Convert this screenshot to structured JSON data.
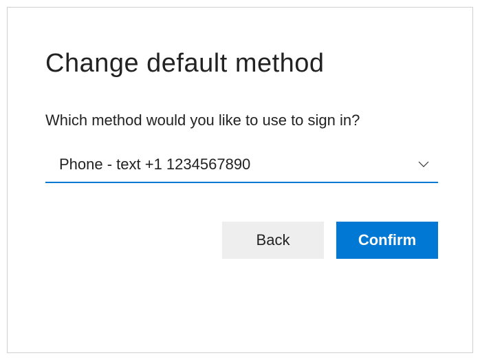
{
  "dialog": {
    "title": "Change default method",
    "prompt": "Which method would you like to use to sign in?",
    "dropdown": {
      "selected": "Phone - text +1 1234567890"
    },
    "buttons": {
      "back": "Back",
      "confirm": "Confirm"
    }
  }
}
